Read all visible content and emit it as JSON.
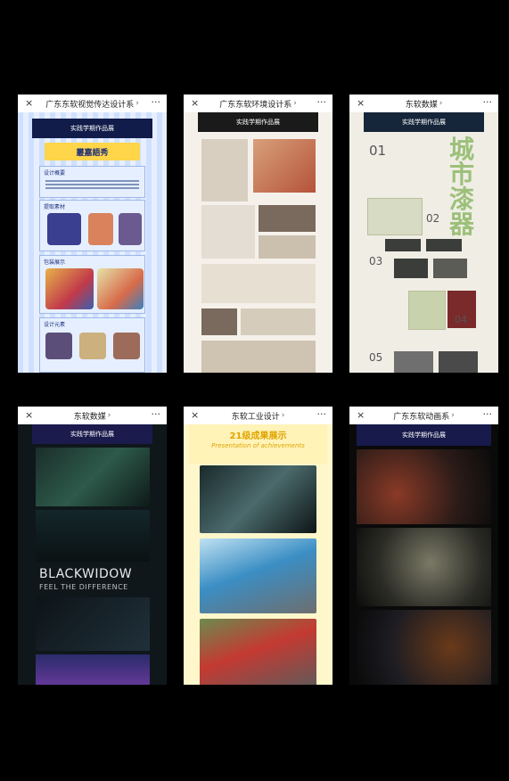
{
  "cards": [
    {
      "title": "广东东软视觉传达设计系",
      "banner": "实践学期作品展",
      "heading": "叢嘉語秀",
      "sections": [
        "设计概要",
        "提取素材",
        "包装展示",
        "设计元素"
      ]
    },
    {
      "title": "广东东软环境设计系",
      "banner": "实践学期作品展"
    },
    {
      "title": "东软数媒",
      "banner": "实践学期作品展",
      "numbers": [
        "01",
        "02",
        "03",
        "04",
        "05"
      ],
      "big_text": "城市漆器"
    },
    {
      "title": "东软数媒",
      "banner": "实践学期作品展",
      "headline": "BLACKWIDOW",
      "subline": "FEEL THE DIFFERENCE"
    },
    {
      "title": "东软工业设计",
      "banner": "21级成果展示",
      "subtitle": "Presentation of achievements"
    },
    {
      "title": "广东东软动画系",
      "banner": "实践学期作品展"
    }
  ],
  "ui": {
    "close": "×",
    "more": "···",
    "chevron": "›"
  }
}
